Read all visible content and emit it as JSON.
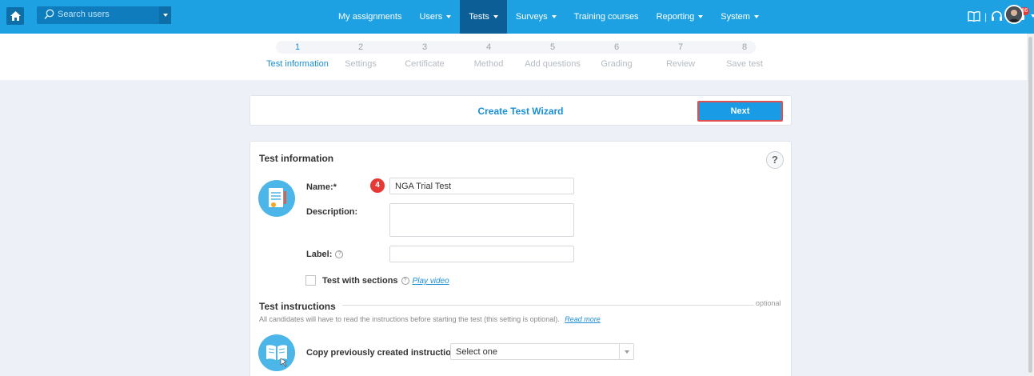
{
  "topbar": {
    "search_placeholder": "Search users",
    "nav": [
      {
        "label": "My assignments",
        "has_caret": false
      },
      {
        "label": "Users",
        "has_caret": true
      },
      {
        "label": "Tests",
        "has_caret": true,
        "active": true
      },
      {
        "label": "Surveys",
        "has_caret": true
      },
      {
        "label": "Training courses",
        "has_caret": false
      },
      {
        "label": "Reporting",
        "has_caret": true
      },
      {
        "label": "System",
        "has_caret": true
      }
    ],
    "notifications_count": "86",
    "icons": [
      "home-icon",
      "search-icon",
      "book-icon",
      "headset-icon",
      "chat-icon",
      "avatar"
    ]
  },
  "stepper": {
    "steps": [
      {
        "num": "1",
        "label": "Test information",
        "active": true
      },
      {
        "num": "2",
        "label": "Settings"
      },
      {
        "num": "3",
        "label": "Certificate"
      },
      {
        "num": "4",
        "label": "Method"
      },
      {
        "num": "5",
        "label": "Add questions"
      },
      {
        "num": "6",
        "label": "Grading"
      },
      {
        "num": "7",
        "label": "Review"
      },
      {
        "num": "8",
        "label": "Save test"
      }
    ]
  },
  "wizard": {
    "title": "Create Test Wizard",
    "next_label": "Next"
  },
  "test_info": {
    "title": "Test information",
    "help": "?",
    "step_marker": "4",
    "name_label": "Name:*",
    "name_value": "NGA Trial Test",
    "description_label": "Description:",
    "label_label": "Label:",
    "sections_label": "Test with sections",
    "play_video": "Play video"
  },
  "instructions": {
    "title": "Test instructions",
    "optional": "optional",
    "description": "All candidates will have to read the instructions before starting the test (this setting is optional).",
    "read_more": "Read more",
    "copy_label": "Copy previously created instructions:",
    "select_value": "Select one"
  },
  "colors": {
    "topbar": "#1da1e2",
    "active_nav": "#0c5f96",
    "accent": "#1a8fd6",
    "highlight_border": "#e15050"
  }
}
